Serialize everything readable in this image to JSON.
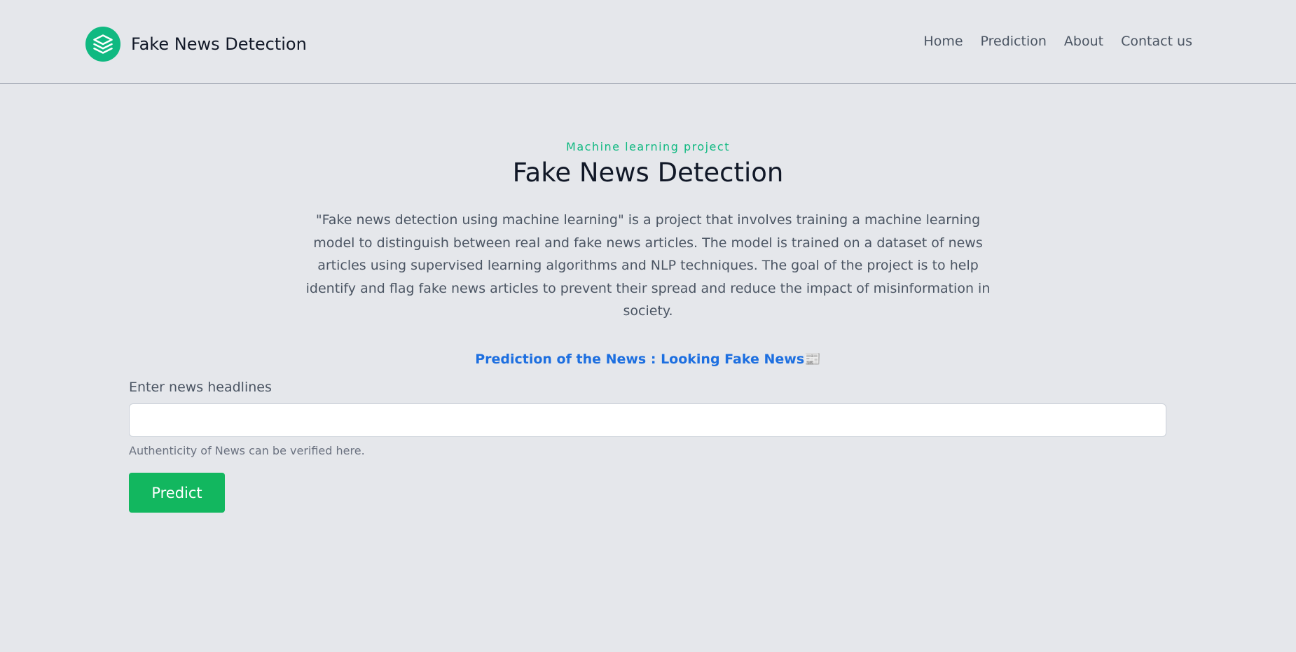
{
  "header": {
    "brand": "Fake News Detection",
    "brand_icon": "stack-layers-icon",
    "brand_color": "#10b981",
    "nav": [
      {
        "label": "Home"
      },
      {
        "label": "Prediction"
      },
      {
        "label": "About"
      },
      {
        "label": "Contact us"
      }
    ]
  },
  "hero": {
    "eyebrow": "Machine learning project",
    "title": "Fake News Detection",
    "description": "\"Fake news detection using machine learning\" is a project that involves training a machine learning model to distinguish between real and fake news articles. The model is trained on a dataset of news articles using supervised learning algorithms and NLP techniques. The goal of the project is to help identify and flag fake news articles to prevent their spread and reduce the impact of misinformation in society.",
    "highlight": "Prediction of the News : Looking Fake News📰"
  },
  "form": {
    "label": "Enter news headlines",
    "input_value": "",
    "input_placeholder": "",
    "help": "Authenticity of News can be verified here.",
    "button": "Predict",
    "button_color": "#12b75f"
  }
}
